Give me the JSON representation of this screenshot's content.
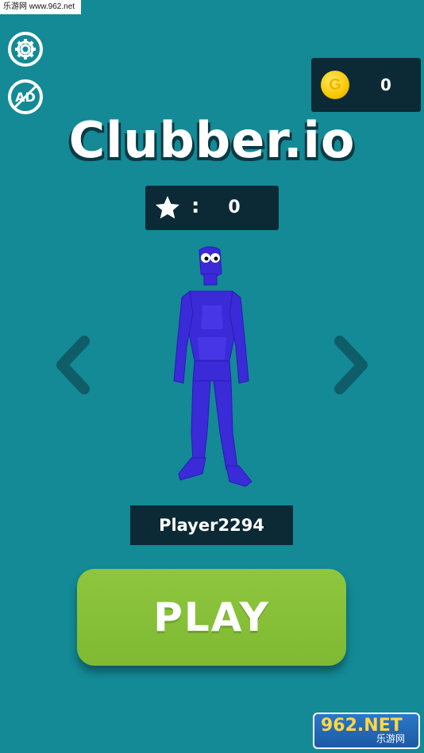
{
  "watermark": {
    "top_text": "乐游网 www.962.net",
    "bottom_main": "962.NET",
    "bottom_sub": "乐游网"
  },
  "icons": {
    "settings": "gear-icon",
    "no_ads": "no-ads-icon",
    "coin": "coin-icon",
    "star": "star-icon",
    "prev": "chevron-left-icon",
    "next": "chevron-right-icon"
  },
  "coin": {
    "symbol": "G",
    "count": "0"
  },
  "title": "Clubber.io",
  "stars": {
    "separator": ":",
    "count": "0"
  },
  "player": {
    "name": "Player2294"
  },
  "play_button": {
    "label": "PLAY"
  },
  "colors": {
    "background": "#138a96",
    "panel": "#0c2a35",
    "play": "#8ec63f",
    "character": "#3a2ad8"
  }
}
